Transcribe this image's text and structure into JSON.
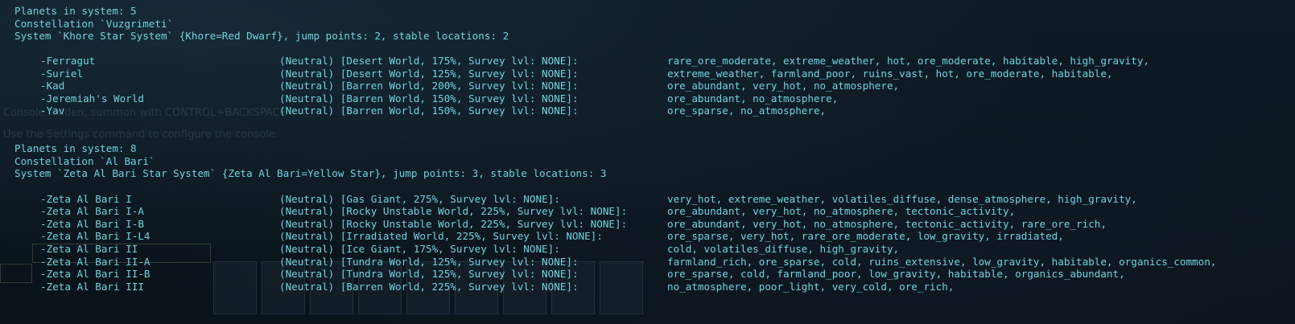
{
  "colors": {
    "console_text": "#6fd4dc",
    "background": "#0b1520"
  },
  "background_ghosts": {
    "console_hint": "Console hidden, summon with CONTROL+BACKSPACE",
    "settings_hint": "Use the Settings command to configure the console."
  },
  "systems": [
    {
      "planets_count_line": "Planets in system: 5",
      "constellation_line": "Constellation `Vuzgrimeti`",
      "system_line": "System `Khore Star System` {Khore=Red Dwarf}, jump points: 2, stable locations: 2",
      "planets": [
        {
          "name": "-Ferragut",
          "info": "(Neutral) [Desert World, 175%, Survey lvl: NONE]:",
          "tags": "rare_ore_moderate, extreme_weather, hot, ore_moderate, habitable, high_gravity,"
        },
        {
          "name": "-Suriel",
          "info": "(Neutral) [Desert World, 125%, Survey lvl: NONE]:",
          "tags": "extreme_weather, farmland_poor, ruins_vast, hot, ore_moderate, habitable,"
        },
        {
          "name": "-Kad",
          "info": "(Neutral) [Barren World, 200%, Survey lvl: NONE]:",
          "tags": "ore_abundant, very_hot, no_atmosphere,"
        },
        {
          "name": "-Jeremiah's World",
          "info": "(Neutral) [Barren World, 150%, Survey lvl: NONE]:",
          "tags": "ore_abundant, no_atmosphere,"
        },
        {
          "name": "-Yav",
          "info": "(Neutral) [Barren World, 150%, Survey lvl: NONE]:",
          "tags": "ore_sparse, no_atmosphere,"
        }
      ]
    },
    {
      "planets_count_line": "Planets in system: 8",
      "constellation_line": "Constellation `Al Bari`",
      "system_line": "System `Zeta Al Bari Star System` {Zeta Al Bari=Yellow Star}, jump points: 3, stable locations: 3",
      "planets": [
        {
          "name": "-Zeta Al Bari I",
          "info": "(Neutral) [Gas Giant, 275%, Survey lvl: NONE]:",
          "tags": "very_hot, extreme_weather, volatiles_diffuse, dense_atmosphere, high_gravity,"
        },
        {
          "name": "-Zeta Al Bari I-A",
          "info": "(Neutral) [Rocky Unstable World, 225%, Survey lvl: NONE]:",
          "tags": "ore_abundant, very_hot, no_atmosphere, tectonic_activity,"
        },
        {
          "name": "-Zeta Al Bari I-B",
          "info": "(Neutral) [Rocky Unstable World, 225%, Survey lvl: NONE]:",
          "tags": "ore_abundant, very_hot, no_atmosphere, tectonic_activity, rare_ore_rich,"
        },
        {
          "name": "-Zeta Al Bari I-L4",
          "info": "(Neutral) [Irradiated World, 225%, Survey lvl: NONE]:",
          "tags": "ore_sparse, very_hot, rare_ore_moderate, low_gravity, irradiated,"
        },
        {
          "name": "-Zeta Al Bari II",
          "info": "(Neutral) [Ice Giant, 175%, Survey lvl: NONE]:",
          "tags": "cold, volatiles_diffuse, high_gravity,"
        },
        {
          "name": "-Zeta Al Bari II-A",
          "info": "(Neutral) [Tundra World, 125%, Survey lvl: NONE]:",
          "tags": "farmland_rich, ore_sparse, cold, ruins_extensive, low_gravity, habitable, organics_common,"
        },
        {
          "name": "-Zeta Al Bari II-B",
          "info": "(Neutral) [Tundra World, 125%, Survey lvl: NONE]:",
          "tags": "ore_sparse, cold, farmland_poor, low_gravity, habitable, organics_abundant,"
        },
        {
          "name": "-Zeta Al Bari III",
          "info": "(Neutral) [Barren World, 225%, Survey lvl: NONE]:",
          "tags": "no_atmosphere, poor_light, very_cold, ore_rich,"
        }
      ]
    }
  ]
}
